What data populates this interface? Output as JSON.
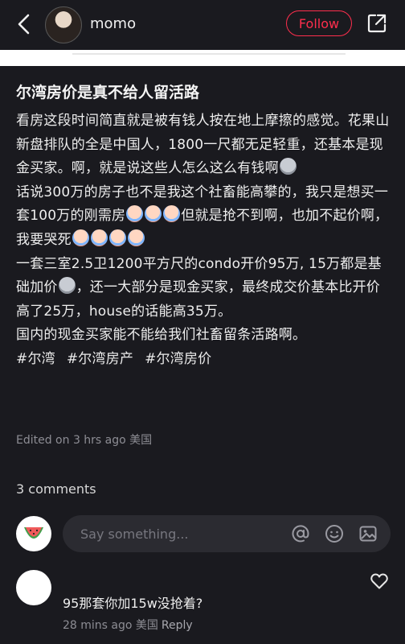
{
  "header": {
    "username": "momo",
    "follow_label": "Follow",
    "icons": [
      "back-chevron-icon",
      "share-icon"
    ]
  },
  "post": {
    "title": "尔湾房价是真不给人留活路",
    "paragraph1": "看房这段时间简直就是被有钱人按在地上摩擦的感觉。花果山新盘排队的全是中国人，1800一尺都无足轻重，还基本是现金买家。啊，就是说这些人怎么这么有钱啊",
    "paragraph2a": "话说300万的房子也不是我这个社畜能高攀的，我只是想买一套100万的刚需房",
    "paragraph2b": "但就是抢不到啊，也加不起价啊，我要哭死",
    "paragraph3a": "一套三室2.5卫1200平方尺的condo开价95万, 15万都是基础加价",
    "paragraph3b": "，还一大部分是现金买家，最终成交价基本比开价高了25万，house的话能高35万。",
    "paragraph4": "国内的现金买家能不能给我们社畜留条活路啊。",
    "tags": [
      "#尔湾",
      "#尔湾房产",
      "#尔湾房价"
    ],
    "edited": "Edited on 3 hrs ago 美国"
  },
  "comments": {
    "count_label": "3 comments",
    "input_placeholder": "Say something...",
    "input_icons": [
      "at-icon",
      "emoji-icon",
      "image-icon"
    ],
    "items": [
      {
        "text": "95那套你加15w没抢着?",
        "meta": "28 mins ago 美国",
        "reply_label": "Reply"
      }
    ]
  },
  "colors": {
    "background": "#1a1a1f",
    "accent": "#ff2e4d",
    "muted": "#8d8d94"
  }
}
